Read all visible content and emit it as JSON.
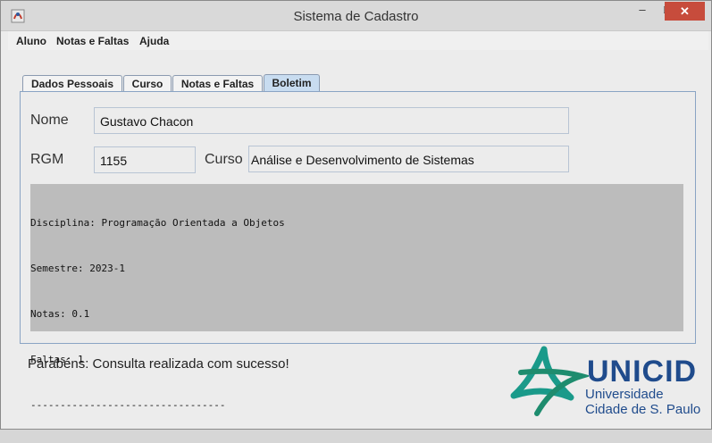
{
  "window": {
    "title": "Sistema de Cadastro",
    "minimize": "–",
    "maximize": "□",
    "close": "✕"
  },
  "menu": {
    "items": [
      "Aluno",
      "Notas e Faltas",
      "Ajuda"
    ]
  },
  "tabs": [
    "Dados Pessoais",
    "Curso",
    "Notas e Faltas",
    "Boletim"
  ],
  "active_tab": "Boletim",
  "form": {
    "nome_label": "Nome",
    "nome_value": "Gustavo Chacon",
    "rgm_label": "RGM",
    "rgm_value": "1155",
    "curso_label": "Curso",
    "curso_value": "Análise e Desenvolvimento de Sistemas"
  },
  "report_lines": [
    "Disciplina: Programação Orientada a Objetos",
    "Semestre: 2023-1",
    "Notas: 0.1",
    "Faltas: 1",
    "---------------------------------"
  ],
  "status_message": "Parabéns: Consulta realizada com sucesso!",
  "logo": {
    "name": "UNICID",
    "line1": "Universidade",
    "line2": "Cidade de S. Paulo",
    "brand_color": "#1f4b8c",
    "star_color": "#1a9a8a"
  }
}
